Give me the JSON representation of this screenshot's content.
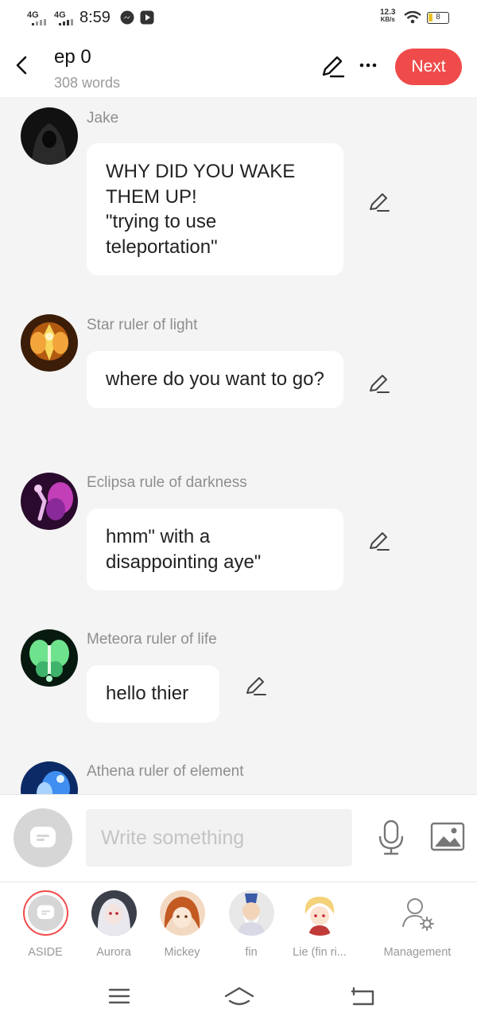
{
  "status_bar": {
    "network_left": "4G",
    "network_right": "4G",
    "time": "8:59",
    "speed_value": "12.3",
    "speed_unit": "KB/s",
    "battery": "8",
    "icons": [
      "messenger-icon",
      "play-icon",
      "wifi-icon",
      "battery-icon"
    ]
  },
  "header": {
    "title": "ep 0",
    "subtitle": "308 words",
    "next_label": "Next",
    "icons": [
      "back-arrow-icon",
      "pencil-icon",
      "more-dots-icon"
    ],
    "accent_color": "#f04b4b"
  },
  "messages": [
    {
      "sender": "Jake",
      "text": "WHY DID YOU WAKE THEM UP!\n\"trying to use teleportation\""
    },
    {
      "sender": "Star ruler of light",
      "text": "where do you want to go?"
    },
    {
      "sender": "Eclipsa rule of darkness",
      "text": "hmm\" with a disappointing aye\""
    },
    {
      "sender": "Meteora ruler of life",
      "text": "hello thier"
    },
    {
      "sender": "Athena ruler of element",
      "text": ""
    }
  ],
  "composer": {
    "placeholder": "Write something",
    "icons": [
      "aside-bubble-icon",
      "microphone-icon",
      "image-icon"
    ]
  },
  "characters": [
    {
      "name": "ASIDE"
    },
    {
      "name": "Aurora"
    },
    {
      "name": "Mickey"
    },
    {
      "name": "fin"
    },
    {
      "name": "Lie (fin ri..."
    },
    {
      "name": "Management"
    }
  ],
  "nav_bar": {
    "icons": [
      "menu-icon",
      "home-icon",
      "back-icon"
    ]
  }
}
